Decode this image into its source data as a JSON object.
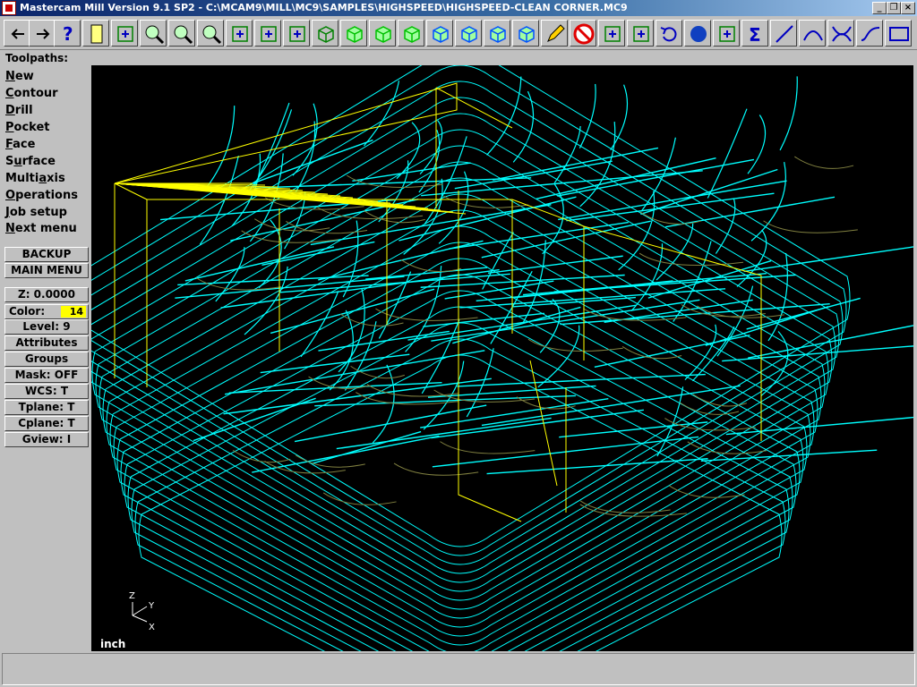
{
  "window": {
    "title": "Mastercam Mill Version 9.1 SP2 - C:\\MCAM9\\MILL\\MC9\\SAMPLES\\HIGHSPEED\\HIGHSPEED-CLEAN CORNER.MC9",
    "controls": {
      "minimize": "_",
      "restore": "❐",
      "close": "×"
    }
  },
  "toolbar": {
    "buttons": [
      "back-arrow-icon",
      "forward-arrow-icon",
      "help-icon",
      "file-icon",
      "pointer-help-icon",
      "zoom-in-icon",
      "zoom-fit-icon",
      "zoom-window-icon",
      "pan-icon",
      "select-icon",
      "rotate-view-icon",
      "cube-wire-icon",
      "cube-green-1-icon",
      "cube-green-2-icon",
      "cube-green-3-icon",
      "cube-blue-1-icon",
      "cube-blue-2-icon",
      "cube-blue-3-icon",
      "cube-blue-4-icon",
      "pencil-icon",
      "no-entry-icon",
      "transform-icon",
      "transform-color-icon",
      "undo-icon",
      "sphere-icon",
      "move-icon",
      "sigma-icon",
      "line-icon",
      "arc-icon",
      "trim-icon",
      "spline-icon",
      "rectangle-icon"
    ]
  },
  "toolpaths_label": "Toolpaths:",
  "menu": {
    "items": [
      {
        "label": "New",
        "mnemonic": "N"
      },
      {
        "label": "Contour",
        "mnemonic": "C"
      },
      {
        "label": "Drill",
        "mnemonic": "D"
      },
      {
        "label": "Pocket",
        "mnemonic": "P"
      },
      {
        "label": "Face",
        "mnemonic": "F"
      },
      {
        "label": "Surface",
        "mnemonic": "u"
      },
      {
        "label": "Multiaxis",
        "mnemonic": "a"
      },
      {
        "label": "Operations",
        "mnemonic": "O"
      },
      {
        "label": "Job setup",
        "mnemonic": "J"
      },
      {
        "label": "Next menu",
        "mnemonic": "N"
      }
    ],
    "backup": "BACKUP",
    "main_menu": "MAIN MENU"
  },
  "settings": {
    "z": "Z:  0.0000",
    "color_label": "Color:",
    "color_value": "14",
    "level": "Level:  9",
    "attributes": "Attributes",
    "groups": "Groups",
    "mask": "Mask:  OFF",
    "wcs": "WCS:   T",
    "tplane": "Tplane:  T",
    "cplane": "Cplane:  T",
    "gview": "Gview:   I"
  },
  "viewport": {
    "units": "inch",
    "axes": {
      "z": "Z",
      "y": "Y",
      "x": "X"
    },
    "colors": {
      "background": "#000000",
      "toolpath": "#00ffff",
      "geometry": "#ffff00",
      "surface": "#808040"
    }
  },
  "status_bar": {
    "text": ""
  }
}
